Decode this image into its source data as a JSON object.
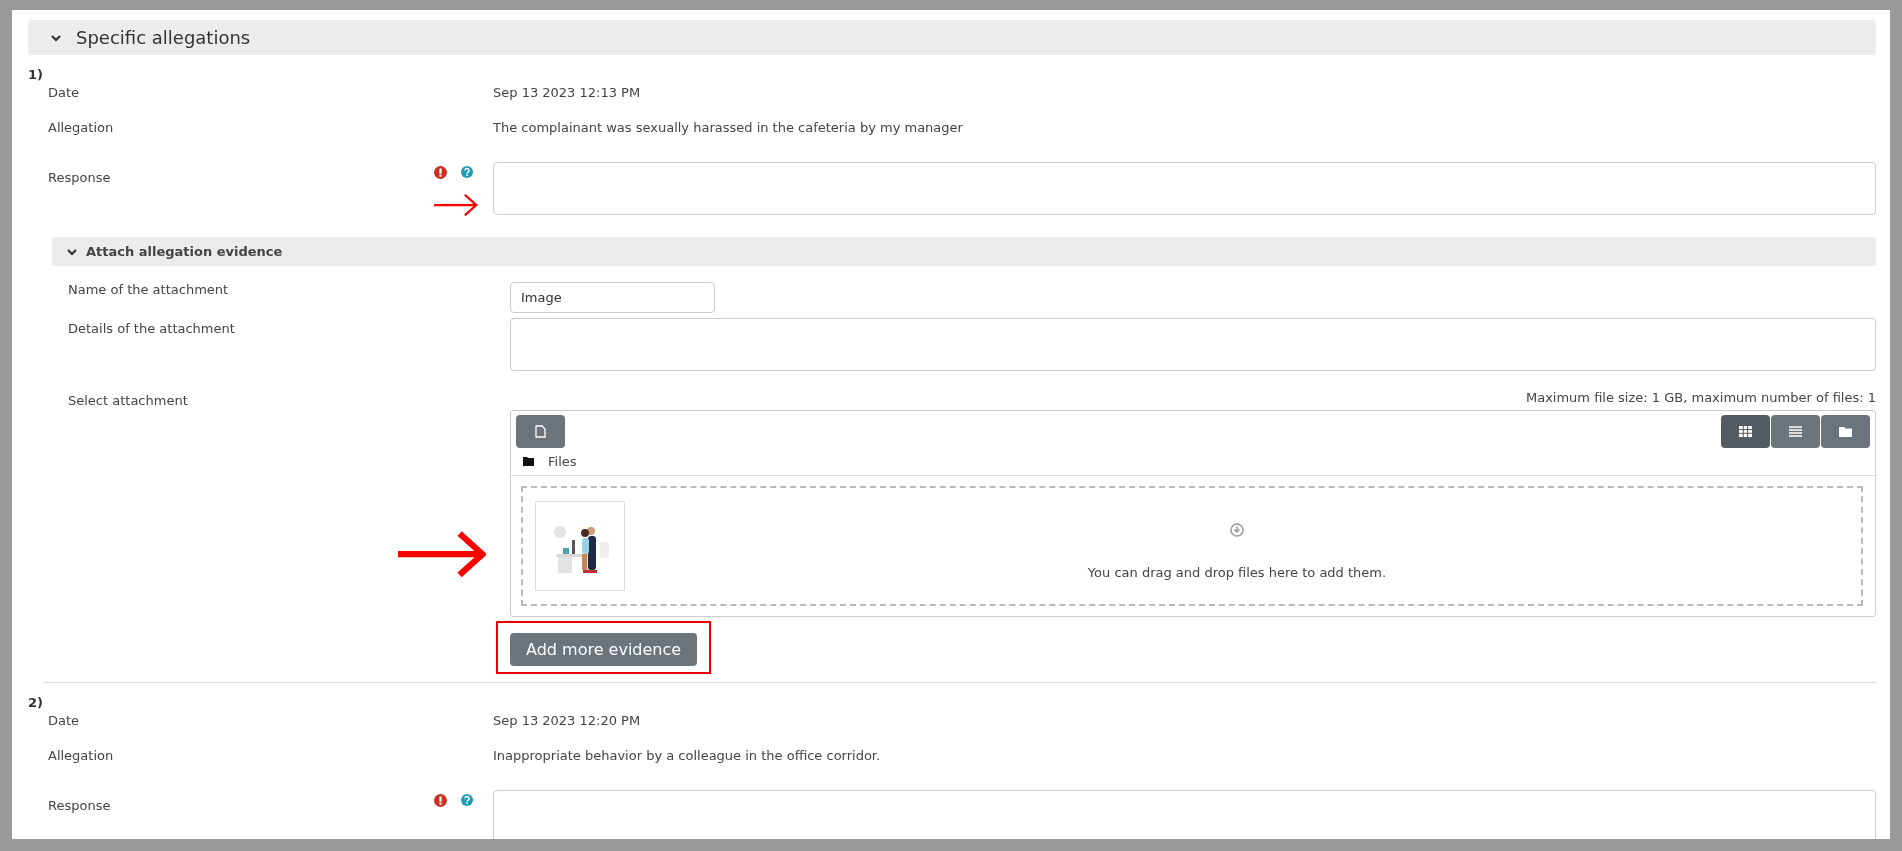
{
  "section": {
    "title": "Specific allegations",
    "expanded": true
  },
  "allegations": [
    {
      "number": "1)",
      "date_label": "Date",
      "date": "Sep 13 2023 12:13 PM",
      "allegation_label": "Allegation",
      "allegation": "The complainant was sexually harassed in the cafeteria by my manager",
      "response_label": "Response",
      "required": true,
      "help": true,
      "arrow": true,
      "evidence": {
        "title": "Attach allegation evidence",
        "expanded": true,
        "name_label": "Name of the attachment",
        "name_value": "Image",
        "details_label": "Details of the attachment",
        "select_label": "Select attachment",
        "limits": "Maximum file size: 1 GB, maximum number of files: 1",
        "folder": "Files",
        "views": [
          {
            "kind": "grid",
            "selected": true
          },
          {
            "kind": "list",
            "selected": false
          },
          {
            "kind": "tree",
            "selected": false
          }
        ],
        "drop_hint": "You can drag and drop files here to add them.",
        "arrow": true
      },
      "add_button": {
        "label": "Add more evidence",
        "highlighted": true
      }
    },
    {
      "number": "2)",
      "date_label": "Date",
      "date": "Sep 13 2023 12:20 PM",
      "allegation_label": "Allegation",
      "allegation": "Inappropriate behavior by a colleague in the office corridor.",
      "response_label": "Response",
      "required": true,
      "help": true
    }
  ]
}
